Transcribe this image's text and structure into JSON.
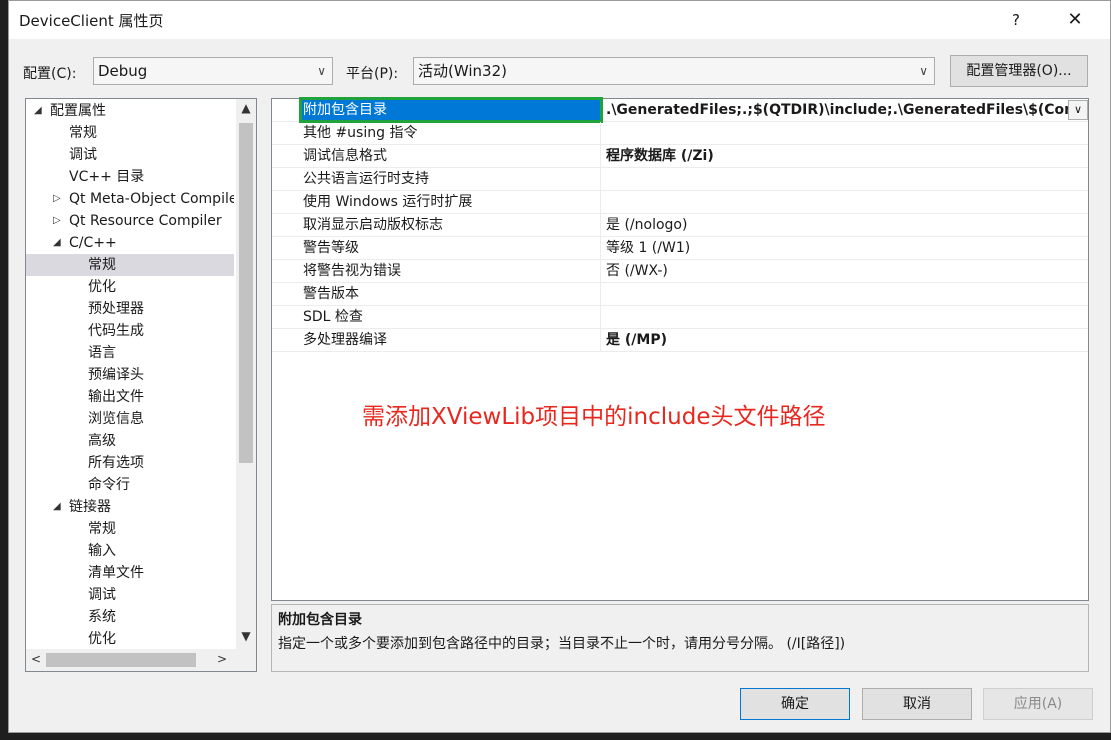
{
  "window": {
    "title": "DeviceClient 属性页",
    "help": "?",
    "close": "✕"
  },
  "config": {
    "config_label": "配置(C):",
    "config_value": "Debug",
    "platform_label": "平台(P):",
    "platform_value": "活动(Win32)",
    "manager_button": "配置管理器(O)...",
    "dropdown_icon": "chevron-down-icon"
  },
  "tree": {
    "items": [
      {
        "label": "配置属性",
        "toggle": "◢"
      },
      {
        "label": "常规"
      },
      {
        "label": "调试"
      },
      {
        "label": "VC++ 目录"
      },
      {
        "label": "Qt Meta-Object Compiler",
        "toggle": "▷"
      },
      {
        "label": "Qt Resource Compiler",
        "toggle": "▷"
      },
      {
        "label": "C/C++",
        "toggle": "◢"
      },
      {
        "label": "常规",
        "selected": true
      },
      {
        "label": "优化"
      },
      {
        "label": "预处理器"
      },
      {
        "label": "代码生成"
      },
      {
        "label": "语言"
      },
      {
        "label": "预编译头"
      },
      {
        "label": "输出文件"
      },
      {
        "label": "浏览信息"
      },
      {
        "label": "高级"
      },
      {
        "label": "所有选项"
      },
      {
        "label": "命令行"
      },
      {
        "label": "链接器",
        "toggle": "◢"
      },
      {
        "label": "常规"
      },
      {
        "label": "输入"
      },
      {
        "label": "清单文件"
      },
      {
        "label": "调试"
      },
      {
        "label": "系统"
      },
      {
        "label": "优化"
      }
    ],
    "scroll_up": "▲",
    "scroll_down": "▼",
    "scroll_left": "<",
    "scroll_right": ">"
  },
  "properties": {
    "rows": [
      {
        "name": "附加包含目录",
        "value": ".\\GeneratedFiles;.;$(QTDIR)\\include;.\\GeneratedFiles\\$(ConfigurationName)",
        "bold": true,
        "selected": true
      },
      {
        "name": "其他 #using 指令",
        "value": ""
      },
      {
        "name": "调试信息格式",
        "value": "程序数据库 (/Zi)",
        "bold": true
      },
      {
        "name": "公共语言运行时支持",
        "value": ""
      },
      {
        "name": "使用 Windows 运行时扩展",
        "value": ""
      },
      {
        "name": "取消显示启动版权标志",
        "value": "是 (/nologo)"
      },
      {
        "name": "警告等级",
        "value": "等级 1 (/W1)"
      },
      {
        "name": "将警告视为错误",
        "value": "否 (/WX-)"
      },
      {
        "name": "警告版本",
        "value": ""
      },
      {
        "name": "SDL 检查",
        "value": ""
      },
      {
        "name": "多处理器编译",
        "value": "是 (/MP)",
        "bold": true
      }
    ],
    "annotation": "需添加XViewLib项目中的include头文件路径",
    "annotation_color": "#e8281e",
    "highlight_color": "#1fa33a"
  },
  "description": {
    "title": "附加包含目录",
    "text": "指定一个或多个要添加到包含路径中的目录；当目录不止一个时，请用分号分隔。      (/I[路径])"
  },
  "footer": {
    "ok": "确定",
    "cancel": "取消",
    "apply": "应用(A)"
  },
  "colors": {
    "selection_blue": "#0078d7",
    "ok_border": "#0078d7"
  }
}
